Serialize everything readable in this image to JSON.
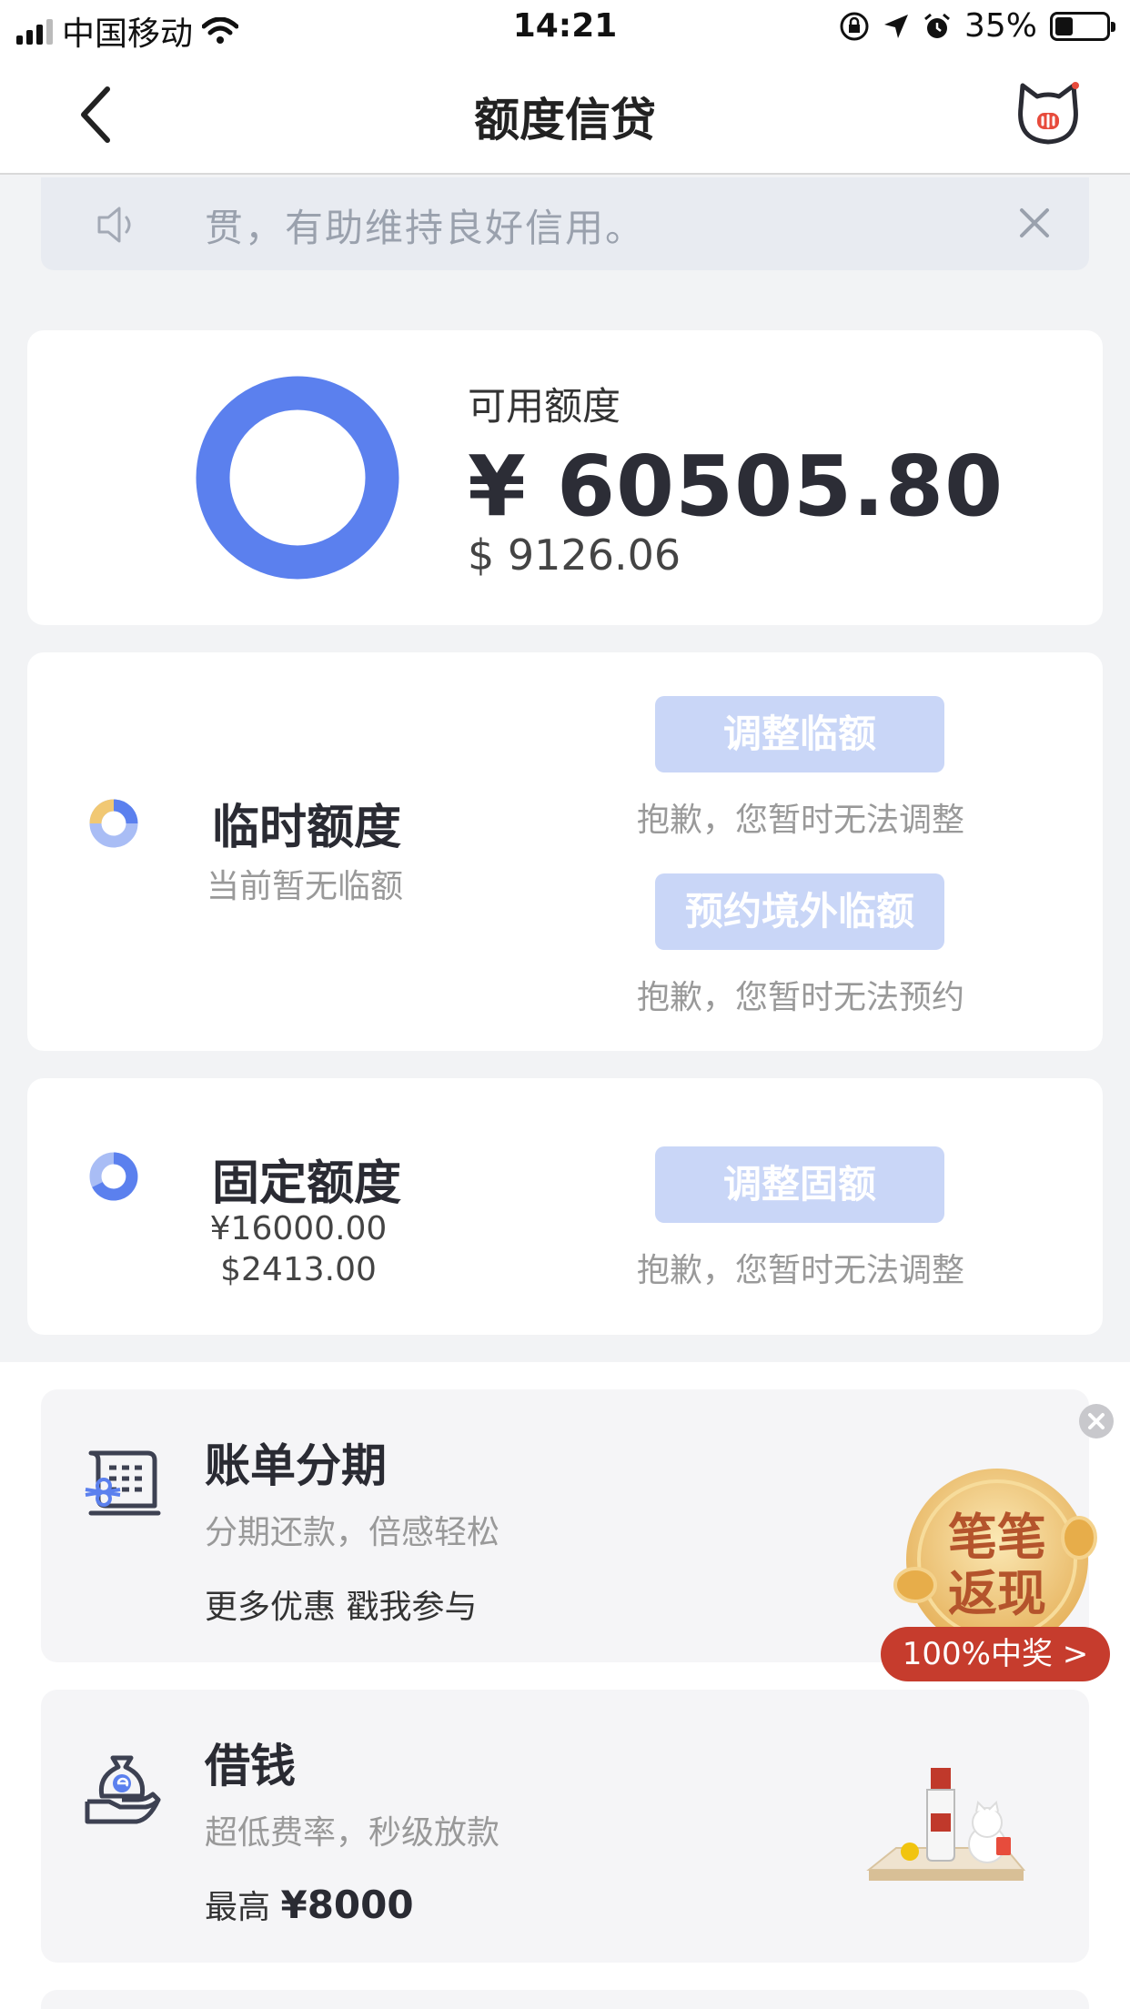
{
  "status_bar": {
    "carrier": "中国移动",
    "time": "14:21",
    "battery": "35%",
    "battery_level": 0.35
  },
  "nav": {
    "title": "额度信贷"
  },
  "notice": {
    "text": "贯，有助维持良好信用。"
  },
  "available": {
    "label": "可用额度",
    "cny": "¥ 60505.80",
    "usd": "$ 9126.06"
  },
  "temporary": {
    "title": "临时额度",
    "subtitle": "当前暂无临额",
    "adjust_button": "调整临额",
    "adjust_note": "抱歉，您暂时无法调整",
    "reserve_button": "预约境外临额",
    "reserve_note": "抱歉，您暂时无法预约"
  },
  "fixed": {
    "title": "固定额度",
    "cny": "¥16000.00",
    "usd": "$2413.00",
    "adjust_button": "调整固额",
    "adjust_note": "抱歉，您暂时无法调整"
  },
  "installment": {
    "title": "账单分期",
    "subtitle": "分期还款，倍感轻松",
    "extra": "更多优惠 戳我参与"
  },
  "loan": {
    "title": "借钱",
    "subtitle": "超低费率，秒级放款",
    "extra_prefix": "最高",
    "extra_amount": "¥8000"
  },
  "cashback_badge": {
    "line1": "笔笔",
    "line2": "返现",
    "pill": "100%中奖 >"
  },
  "colors": {
    "accent": "#5b80ee",
    "button_disabled": "#c9d6f7",
    "badge_red": "#c63c2d",
    "gold": "#e6b25c"
  }
}
